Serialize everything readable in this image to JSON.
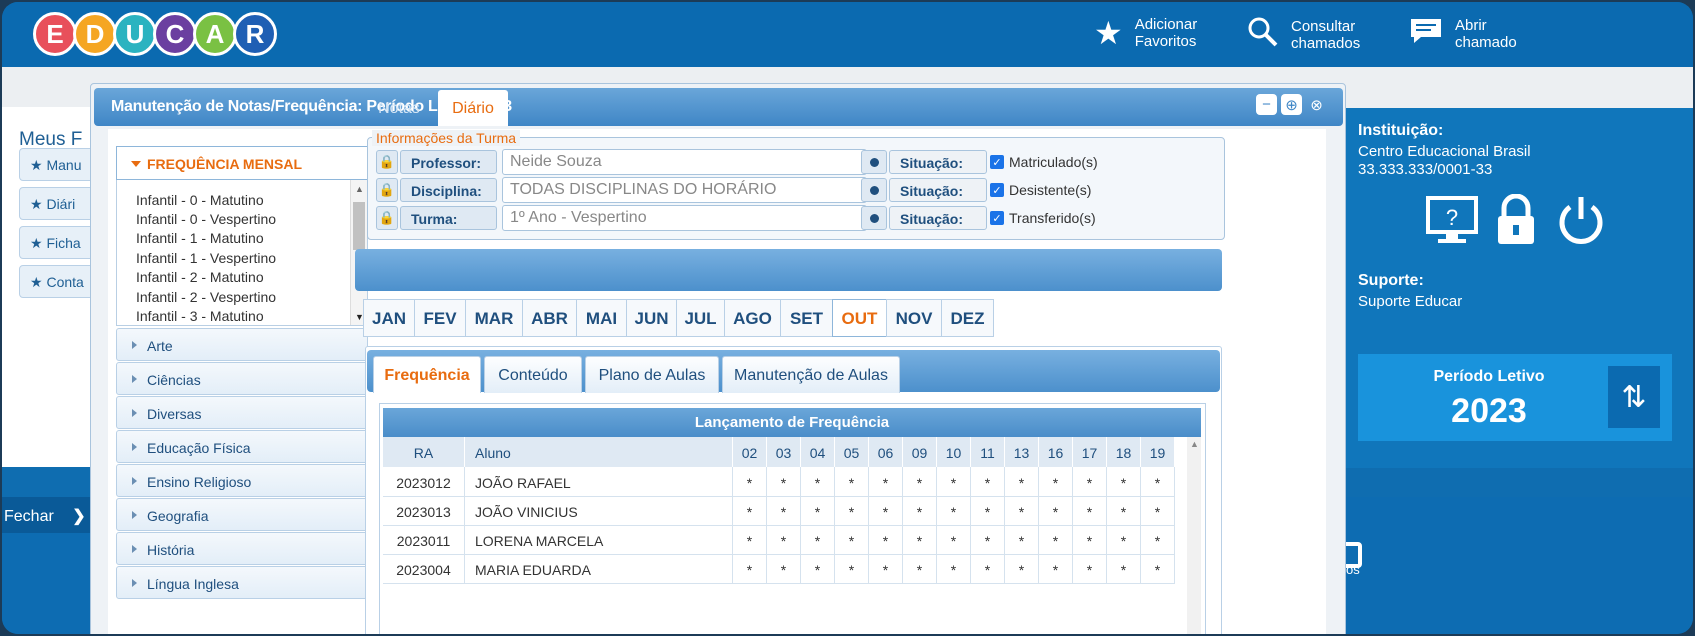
{
  "brand": {
    "letters": [
      "E",
      "D",
      "U",
      "C",
      "A",
      "R"
    ],
    "colors": [
      "#e8505b",
      "#f5a623",
      "#2bb3c0",
      "#6b3fa0",
      "#7ac143",
      "#1f5fb4"
    ]
  },
  "topbar": {
    "fav_line1": "Adicionar",
    "fav_line2": "Favoritos",
    "consult_line1": "Consultar",
    "consult_line2": "chamados",
    "open_line1": "Abrir",
    "open_line2": "chamado"
  },
  "left": {
    "title": "Meus F",
    "items": [
      "Manu",
      "Diári",
      "Ficha",
      "Conta"
    ],
    "close": "Fechar"
  },
  "dialog": {
    "title": "Manutenção de Notas/Frequência: Período Letivo 2023"
  },
  "sidebar": {
    "head": "FREQUÊNCIA MENSAL",
    "classes": [
      "Infantil - 0 - Matutino",
      "Infantil - 0 - Vespertino",
      "Infantil - 1 - Matutino",
      "Infantil - 1 - Vespertino",
      "Infantil - 2 - Matutino",
      "Infantil - 2 - Vespertino",
      "Infantil - 3 - Matutino"
    ],
    "subjects": [
      "Arte",
      "Ciências",
      "Diversas",
      "Educação Física",
      "Ensino Religioso",
      "Geografia",
      "História",
      "Língua Inglesa"
    ]
  },
  "info": {
    "legend": "Informações da Turma",
    "professor_label": "Professor:",
    "professor_value": "Neide Souza",
    "disciplina_label": "Disciplina:",
    "disciplina_value": "TODAS DISCIPLINAS DO HORÁRIO",
    "turma_label": "Turma:",
    "turma_value": "1º Ano - Vespertino",
    "situacao_label": "Situação:",
    "checks": [
      "Matriculado(s)",
      "Desistente(s)",
      "Transferido(s)"
    ]
  },
  "tabs": {
    "notas": "Notas",
    "diario": "Diário"
  },
  "months": [
    "JAN",
    "FEV",
    "MAR",
    "ABR",
    "MAI",
    "JUN",
    "JUL",
    "AGO",
    "SET",
    "OUT",
    "NOV",
    "DEZ"
  ],
  "selected_month": "OUT",
  "subtabs": [
    "Frequência",
    "Conteúdo",
    "Plano de Aulas",
    "Manutenção de Aulas"
  ],
  "grid": {
    "title": "Lançamento de Frequência",
    "col_ra": "RA",
    "col_aluno": "Aluno",
    "days": [
      "02",
      "03",
      "04",
      "05",
      "06",
      "09",
      "10",
      "11",
      "13",
      "16",
      "17",
      "18",
      "19"
    ],
    "mark": "*",
    "rows": [
      {
        "ra": "2023012",
        "aluno": "JOÃO RAFAEL"
      },
      {
        "ra": "2023013",
        "aluno": "JOÃO VINICIUS"
      },
      {
        "ra": "2023011",
        "aluno": "LORENA MARCELA"
      },
      {
        "ra": "2023004",
        "aluno": "MARIA EDUARDA"
      }
    ]
  },
  "right": {
    "inst_label": "Instituição:",
    "inst_name": "Centro Educacional Brasil",
    "inst_cnpj": "33.333.333/0001-33",
    "sup_label": "Suporte:",
    "sup_name": "Suporte Educar",
    "periodo_label": "Período Letivo",
    "periodo_year": "2023",
    "bottom_text": "os"
  }
}
